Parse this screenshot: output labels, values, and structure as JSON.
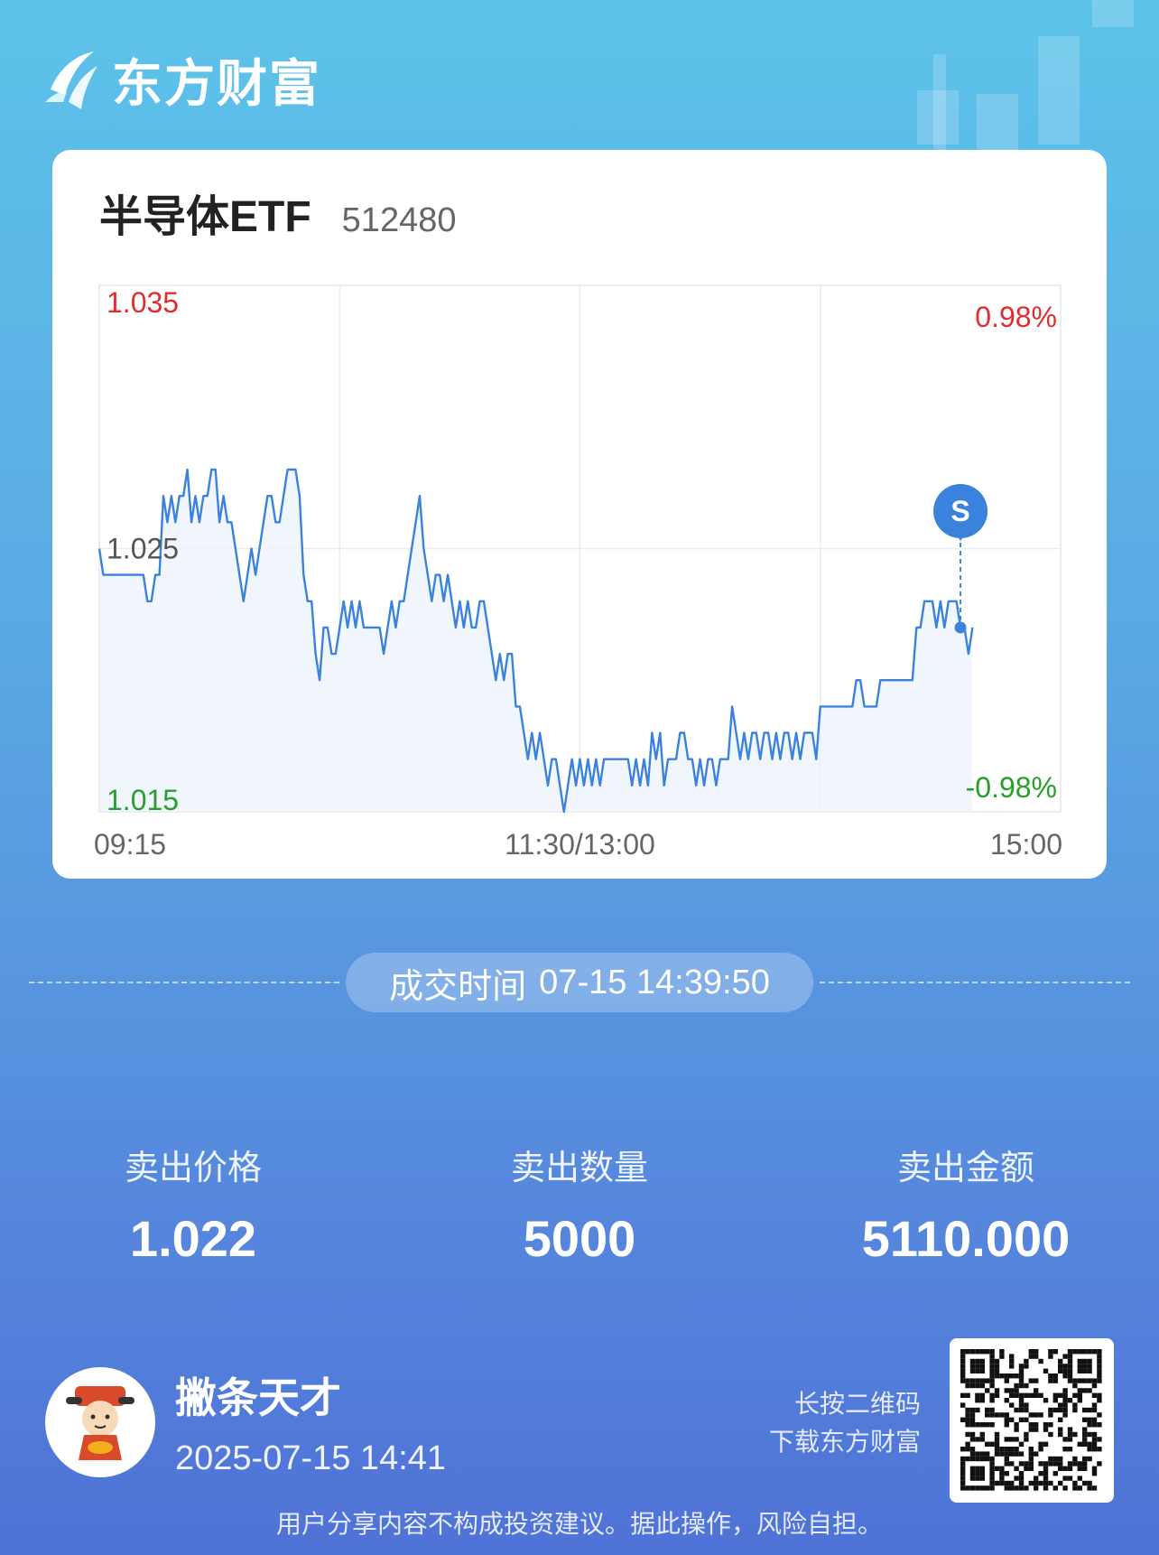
{
  "brand": {
    "name": "东方财富"
  },
  "stock": {
    "name": "半导体ETF",
    "code": "512480"
  },
  "chart_data": {
    "type": "line",
    "y_left_ticks": [
      "1.035",
      "1.025",
      "1.015"
    ],
    "y_right_ticks": [
      "0.98%",
      "-0.98%"
    ],
    "x_ticks": [
      "09:15",
      "11:30/13:00",
      "15:00"
    ],
    "ylim": [
      1.015,
      1.035
    ],
    "base_price": 1.025,
    "marker": {
      "label": "S",
      "price": 1.022
    },
    "colors": {
      "line": "#3b82dc",
      "up": "#e02d2d",
      "down": "#27a02b",
      "neutral": "#555555"
    },
    "values": [
      1.025,
      1.024,
      1.024,
      1.024,
      1.024,
      1.024,
      1.024,
      1.024,
      1.024,
      1.024,
      1.024,
      1.024,
      1.023,
      1.023,
      1.024,
      1.024,
      1.027,
      1.026,
      1.027,
      1.026,
      1.027,
      1.027,
      1.028,
      1.026,
      1.027,
      1.026,
      1.027,
      1.027,
      1.028,
      1.028,
      1.026,
      1.027,
      1.026,
      1.026,
      1.025,
      1.024,
      1.023,
      1.024,
      1.025,
      1.024,
      1.025,
      1.026,
      1.027,
      1.027,
      1.026,
      1.026,
      1.027,
      1.028,
      1.028,
      1.028,
      1.027,
      1.024,
      1.023,
      1.023,
      1.021,
      1.02,
      1.022,
      1.022,
      1.021,
      1.021,
      1.022,
      1.023,
      1.022,
      1.023,
      1.022,
      1.023,
      1.022,
      1.022,
      1.022,
      1.022,
      1.022,
      1.021,
      1.022,
      1.023,
      1.022,
      1.023,
      1.023,
      1.024,
      1.025,
      1.026,
      1.027,
      1.025,
      1.024,
      1.023,
      1.024,
      1.024,
      1.023,
      1.024,
      1.023,
      1.022,
      1.023,
      1.022,
      1.023,
      1.022,
      1.022,
      1.023,
      1.023,
      1.022,
      1.021,
      1.02,
      1.021,
      1.02,
      1.021,
      1.021,
      1.019,
      1.019,
      1.018,
      1.017,
      1.018,
      1.017,
      1.018,
      1.017,
      1.016,
      1.017,
      1.017,
      1.016,
      1.015,
      1.016,
      1.017,
      1.016,
      1.017,
      1.016,
      1.017,
      1.016,
      1.017,
      1.016,
      1.017,
      1.017,
      1.017,
      1.017,
      1.017,
      1.017,
      1.017,
      1.016,
      1.017,
      1.016,
      1.017,
      1.016,
      1.018,
      1.017,
      1.018,
      1.016,
      1.017,
      1.017,
      1.017,
      1.018,
      1.018,
      1.017,
      1.017,
      1.016,
      1.017,
      1.016,
      1.017,
      1.017,
      1.016,
      1.017,
      1.017,
      1.017,
      1.019,
      1.018,
      1.017,
      1.018,
      1.017,
      1.018,
      1.018,
      1.017,
      1.018,
      1.018,
      1.017,
      1.018,
      1.017,
      1.018,
      1.018,
      1.017,
      1.018,
      1.017,
      1.018,
      1.018,
      1.018,
      1.017,
      1.019,
      1.019,
      1.019,
      1.019,
      1.019,
      1.019,
      1.019,
      1.019,
      1.019,
      1.02,
      1.02,
      1.019,
      1.019,
      1.019,
      1.019,
      1.02,
      1.02,
      1.02,
      1.02,
      1.02,
      1.02,
      1.02,
      1.02,
      1.02,
      1.022,
      1.022,
      1.023,
      1.023,
      1.023,
      1.022,
      1.023,
      1.022,
      1.023,
      1.023,
      1.023,
      1.022,
      1.022,
      1.021,
      1.022
    ]
  },
  "trade_time": {
    "label": "成交时间",
    "value": "07-15 14:39:50"
  },
  "stats": [
    {
      "label": "卖出价格",
      "value": "1.022"
    },
    {
      "label": "卖出数量",
      "value": "5000"
    },
    {
      "label": "卖出金额",
      "value": "5110.000"
    }
  ],
  "user": {
    "name": "撇条天才",
    "time": "2025-07-15 14:41"
  },
  "qr": {
    "hint_line1": "长按二维码",
    "hint_line2": "下载东方财富"
  },
  "disclaimer": "用户分享内容不构成投资建议。据此操作，风险自担。"
}
